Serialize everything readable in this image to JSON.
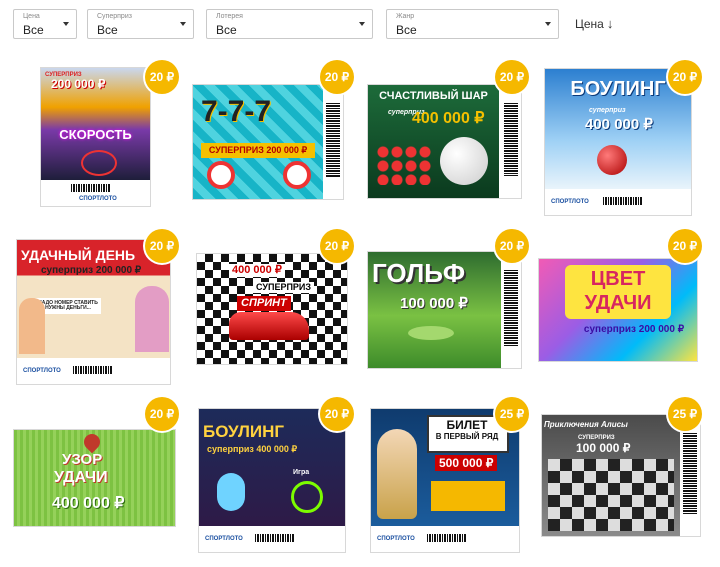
{
  "filters": [
    {
      "label": "Цена",
      "value": "Все"
    },
    {
      "label": "Суперприз",
      "value": "Все"
    },
    {
      "label": "Лотерея",
      "value": "Все"
    },
    {
      "label": "Жанр",
      "value": "Все"
    }
  ],
  "sort": {
    "label": "Цена",
    "arrow": "↓"
  },
  "brand": "СПОРТЛОТО",
  "tickets": [
    {
      "price": "20 ₽",
      "l1": "СУПЕРПРИЗ",
      "l2": "200 000 ₽",
      "l3": "СКОРОСТЬ"
    },
    {
      "price": "20 ₽",
      "l1": "7-7-7",
      "l2": "СУПЕРПРИЗ 200 000 ₽",
      "l3": ""
    },
    {
      "price": "20 ₽",
      "l1": "СЧАСТЛИВЫЙ ШАР",
      "l2": "суперприз",
      "l3": "400 000 ₽"
    },
    {
      "price": "20 ₽",
      "l1": "БОУЛИНГ",
      "l2": "суперприз",
      "l3": "400 000 ₽"
    },
    {
      "price": "20 ₽",
      "l1": "УДАЧНЫЙ ДЕНЬ",
      "l2": "суперприз 200 000 ₽",
      "l3": "НАДО НОМЕР СТАВИТЬ НУЖНЫ ДЕНЬГИ..."
    },
    {
      "price": "20 ₽",
      "l1": "400 000 ₽",
      "l2": "СУПЕРПРИЗ",
      "l3": "СПРИНТ"
    },
    {
      "price": "20 ₽",
      "l1": "ГОЛЬФ",
      "l2": "100 000 ₽",
      "l3": ""
    },
    {
      "price": "20 ₽",
      "l1": "ЦВЕТ",
      "l2": "УДАЧИ",
      "l3": "суперприз 200 000 ₽"
    },
    {
      "price": "20 ₽",
      "l1": "УЗОР",
      "l2": "УДАЧИ",
      "l3": "400 000 ₽"
    },
    {
      "price": "20 ₽",
      "l1": "БОУЛИНГ",
      "l2": "суперприз 400 000 ₽",
      "l3": "Игра"
    },
    {
      "price": "25 ₽",
      "l1": "БИЛЕТ",
      "l2": "В ПЕРВЫЙ РЯД",
      "l3": "500 000 ₽"
    },
    {
      "price": "25 ₽",
      "l1": "Приключения Алисы",
      "l2": "СУПЕРПРИЗ",
      "l3": "100 000 ₽"
    }
  ]
}
